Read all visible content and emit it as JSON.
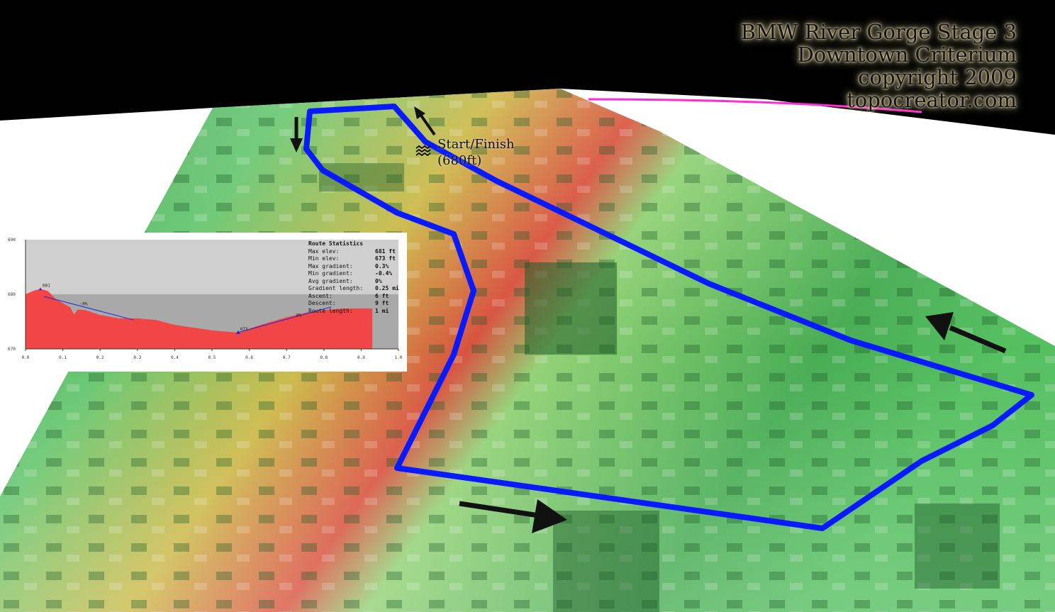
{
  "title": {
    "line1": "BMW River Gorge Stage 3",
    "line2": "Downtown Criterium",
    "line3": "copyright 2009",
    "line4": "topocreator.com"
  },
  "start_label": {
    "line1": "Start/Finish",
    "line2": "(680ft)"
  },
  "colors": {
    "route": "#0a1aff",
    "terrain_low": "#2fa84a",
    "terrain_high": "#c41f1f",
    "terrain_mid": "#c9b640",
    "horizon_line": "#ff2ad4",
    "sky": "#000000",
    "profile_fill": "#f24545",
    "profile_bg_upper": "#cfcfcf",
    "profile_bg_lower": "#a9a9a9",
    "gradient_line": "#1b2bdc"
  },
  "stats": {
    "title": "Route Statistics",
    "rows": [
      {
        "label": "Max elev:",
        "value": "681 ft"
      },
      {
        "label": "Min elev:",
        "value": "673 ft"
      },
      {
        "label": "Max gradient:",
        "value": "0.3%"
      },
      {
        "label": "Min gradient:",
        "value": "-0.4%"
      },
      {
        "label": "Avg gradient:",
        "value": "0%"
      },
      {
        "label": "Gradient length:",
        "value": "0.25 mi"
      },
      {
        "label": "Ascent:",
        "value": "6 ft"
      },
      {
        "label": "Descent:",
        "value": "9 ft"
      },
      {
        "label": "Route length:",
        "value": "1 mi"
      }
    ]
  },
  "chart_data": {
    "type": "area",
    "x": [
      0.0,
      0.02,
      0.04,
      0.06,
      0.08,
      0.1,
      0.12,
      0.13,
      0.14,
      0.16,
      0.2,
      0.25,
      0.3,
      0.35,
      0.4,
      0.45,
      0.5,
      0.55,
      0.57,
      0.6,
      0.65,
      0.7,
      0.75,
      0.8,
      0.85,
      0.9,
      0.93
    ],
    "y": [
      680,
      680.6,
      681,
      680.6,
      679.2,
      678.4,
      677.6,
      676.3,
      677.2,
      677.1,
      676.2,
      675.6,
      675.6,
      675.3,
      674.4,
      673.9,
      673.4,
      673.1,
      673.0,
      673.7,
      674.8,
      675.8,
      676.6,
      677.1,
      677.4,
      677.4,
      677.4
    ],
    "xlim": [
      0.0,
      1.0
    ],
    "ylim": [
      670,
      690
    ],
    "x_ticks": [
      "0.0",
      "0.1",
      "0.2",
      "0.3",
      "0.4",
      "0.5",
      "0.6",
      "0.7",
      "0.8",
      "0.9",
      "1.0"
    ],
    "y_ticks": [
      "670",
      "680",
      "690"
    ],
    "annotations": [
      {
        "text": "681",
        "x": 0.04,
        "y": 681
      },
      {
        "text": "673",
        "x": 0.57,
        "y": 673
      },
      {
        "text": "-0%",
        "x": 0.14,
        "y": 677.6
      },
      {
        "text": "0%",
        "x": 0.72,
        "y": 675.5
      }
    ],
    "gradient_segments": [
      {
        "x": [
          0.05,
          0.29
        ],
        "y": [
          679.6,
          675.3
        ]
      },
      {
        "x": [
          0.57,
          0.82
        ],
        "y": [
          673.0,
          677.7
        ]
      }
    ]
  }
}
